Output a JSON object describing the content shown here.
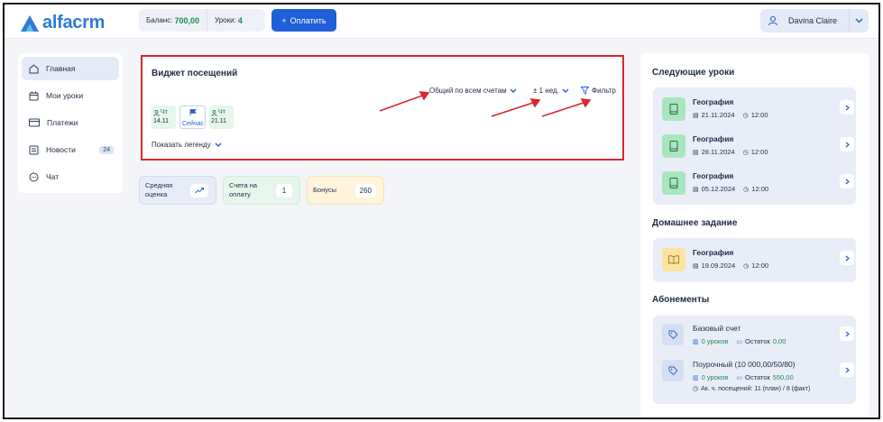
{
  "brand": {
    "name": "alfacrm"
  },
  "header": {
    "balance_label": "Баланс:",
    "balance_value": "700,00",
    "lessons_label": "Уроки:",
    "lessons_value": "4",
    "pay_button": "Оплатить",
    "user_name": "Davina Claire"
  },
  "sidebar": {
    "items": [
      {
        "label": "Главная",
        "icon": "home-icon",
        "active": true
      },
      {
        "label": "Мои уроки",
        "icon": "calendar-icon"
      },
      {
        "label": "Платежи",
        "icon": "card-icon"
      },
      {
        "label": "Новости",
        "icon": "news-icon",
        "badge": "24"
      },
      {
        "label": "Чат",
        "icon": "chat-icon"
      }
    ]
  },
  "widget": {
    "title": "Виджет посещений",
    "account_filter": "Общий по всем счетам",
    "period_filter": "± 1 нед.",
    "filter_button": "Фильтр",
    "days": [
      {
        "weekday": "Чт",
        "date": "14.11"
      },
      {
        "label": "Сейчас"
      },
      {
        "weekday": "Чт",
        "date": "21.11"
      }
    ],
    "show_legend": "Показать легенду"
  },
  "stats": [
    {
      "label_1": "Средняя",
      "label_2": "оценка",
      "value_icon": "trend-icon",
      "bg": "#e7ecf8"
    },
    {
      "label_1": "Счета на",
      "label_2": "оплату",
      "value": "1",
      "bg": "#e6f6ec"
    },
    {
      "label_1": "Бонусы",
      "value": "260",
      "bg": "#fff4dc"
    }
  ],
  "next_lessons": {
    "title": "Следующие уроки",
    "items": [
      {
        "subject": "География",
        "date": "21.11.2024",
        "time": "12:00"
      },
      {
        "subject": "География",
        "date": "28.11.2024",
        "time": "12:00"
      },
      {
        "subject": "География",
        "date": "05.12.2024",
        "time": "12:00"
      }
    ]
  },
  "homework": {
    "title": "Домашнее задание",
    "items": [
      {
        "subject": "География",
        "date": "19.09.2024",
        "time": "12:00"
      }
    ]
  },
  "subscriptions": {
    "title": "Абонементы",
    "items": [
      {
        "name": "Базовый счет",
        "lessons": "0 уроков",
        "remainder_label": "Остаток",
        "remainder": "0,00"
      },
      {
        "name": "Поурочный (10 000,00/50/80)",
        "lessons": "0 уроков",
        "remainder_label": "Остаток",
        "remainder": "550,00",
        "hours": "Ак. ч. посещений: 11 (план) / 8 (факт)"
      }
    ]
  },
  "colors": {
    "accent": "#1f5fd8",
    "highlight": "#d9272e",
    "lesson_icon_bg": "#a8e6bf",
    "homework_icon_bg": "#fbe3a0"
  }
}
